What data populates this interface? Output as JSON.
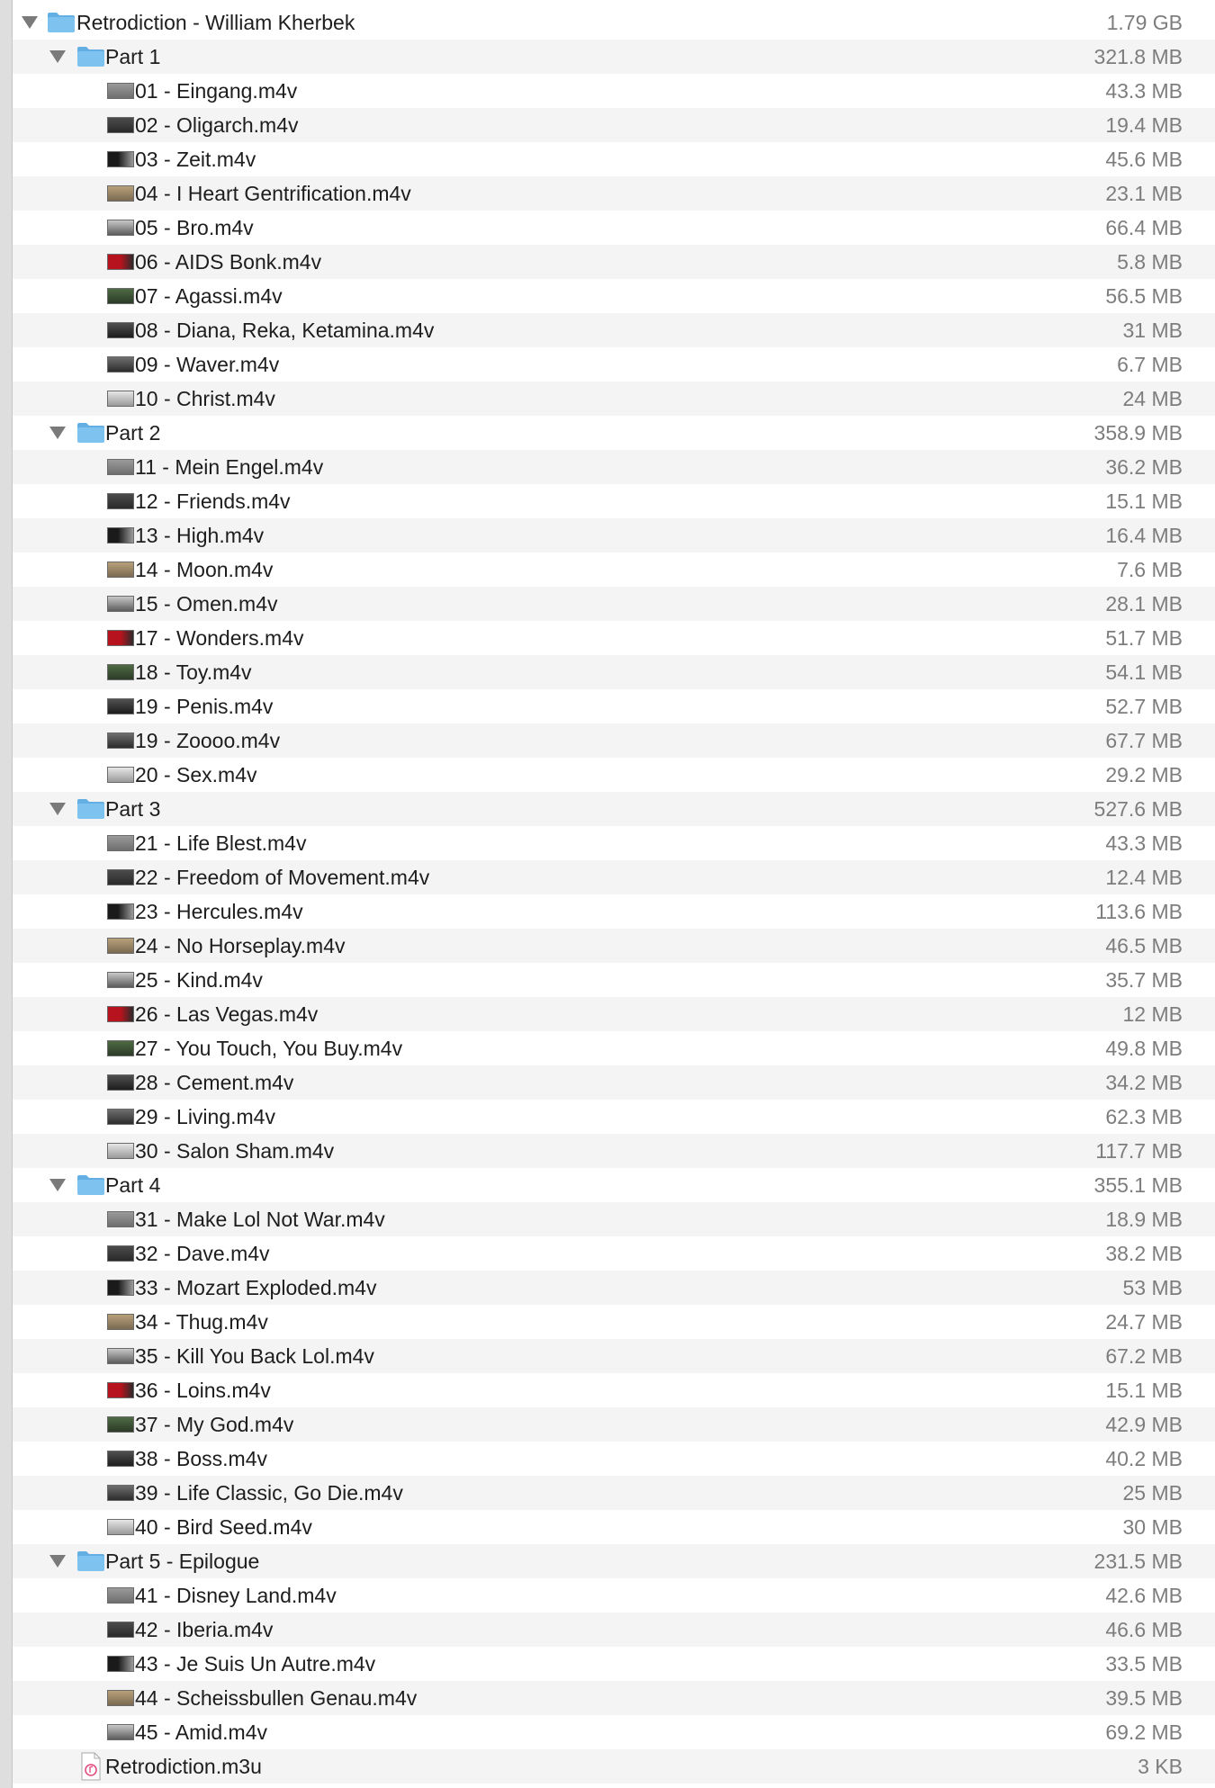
{
  "root": {
    "name": "Retrodiction - William Kherbek",
    "size": "1.79 GB"
  },
  "groups": [
    {
      "name": "Part 1",
      "size": "321.8 MB",
      "files": [
        {
          "name": "01 - Eingang.m4v",
          "size": "43.3 MB"
        },
        {
          "name": "02 - Oligarch.m4v",
          "size": "19.4 MB"
        },
        {
          "name": "03 - Zeit.m4v",
          "size": "45.6 MB"
        },
        {
          "name": "04 - I Heart Gentrification.m4v",
          "size": "23.1 MB"
        },
        {
          "name": "05 - Bro.m4v",
          "size": "66.4 MB"
        },
        {
          "name": "06 - AIDS Bonk.m4v",
          "size": "5.8 MB"
        },
        {
          "name": "07 - Agassi.m4v",
          "size": "56.5 MB"
        },
        {
          "name": "08 - Diana, Reka, Ketamina.m4v",
          "size": "31 MB"
        },
        {
          "name": "09 - Waver.m4v",
          "size": "6.7 MB"
        },
        {
          "name": "10 - Christ.m4v",
          "size": "24 MB"
        }
      ]
    },
    {
      "name": "Part 2",
      "size": "358.9 MB",
      "files": [
        {
          "name": "11 - Mein Engel.m4v",
          "size": "36.2 MB"
        },
        {
          "name": "12 - Friends.m4v",
          "size": "15.1 MB"
        },
        {
          "name": "13 - High.m4v",
          "size": "16.4 MB"
        },
        {
          "name": "14 - Moon.m4v",
          "size": "7.6 MB"
        },
        {
          "name": "15 - Omen.m4v",
          "size": "28.1 MB"
        },
        {
          "name": "17 - Wonders.m4v",
          "size": "51.7 MB"
        },
        {
          "name": "18 - Toy.m4v",
          "size": "54.1 MB"
        },
        {
          "name": "19 - Penis.m4v",
          "size": "52.7 MB"
        },
        {
          "name": "19 - Zoooo.m4v",
          "size": "67.7 MB"
        },
        {
          "name": "20 - Sex.m4v",
          "size": "29.2 MB"
        }
      ]
    },
    {
      "name": "Part 3",
      "size": "527.6 MB",
      "files": [
        {
          "name": "21 - Life Blest.m4v",
          "size": "43.3 MB"
        },
        {
          "name": "22 - Freedom of Movement.m4v",
          "size": "12.4 MB"
        },
        {
          "name": "23 - Hercules.m4v",
          "size": "113.6 MB"
        },
        {
          "name": "24 - No Horseplay.m4v",
          "size": "46.5 MB"
        },
        {
          "name": "25 - Kind.m4v",
          "size": "35.7 MB"
        },
        {
          "name": "26 - Las Vegas.m4v",
          "size": "12 MB"
        },
        {
          "name": "27 - You Touch, You Buy.m4v",
          "size": "49.8 MB"
        },
        {
          "name": "28 - Cement.m4v",
          "size": "34.2 MB"
        },
        {
          "name": "29 - Living.m4v",
          "size": "62.3 MB"
        },
        {
          "name": "30 - Salon Sham.m4v",
          "size": "117.7 MB"
        }
      ]
    },
    {
      "name": "Part 4",
      "size": "355.1 MB",
      "files": [
        {
          "name": "31 - Make Lol Not War.m4v",
          "size": "18.9 MB"
        },
        {
          "name": "32 - Dave.m4v",
          "size": "38.2 MB"
        },
        {
          "name": "33 - Mozart Exploded.m4v",
          "size": "53 MB"
        },
        {
          "name": "34 - Thug.m4v",
          "size": "24.7 MB"
        },
        {
          "name": "35 - Kill You Back Lol.m4v",
          "size": "67.2 MB"
        },
        {
          "name": "36 - Loins.m4v",
          "size": "15.1 MB"
        },
        {
          "name": "37 - My God.m4v",
          "size": "42.9 MB"
        },
        {
          "name": "38 - Boss.m4v",
          "size": "40.2 MB"
        },
        {
          "name": "39 - Life Classic, Go Die.m4v",
          "size": "25 MB"
        },
        {
          "name": "40 - Bird Seed.m4v",
          "size": "30 MB"
        }
      ]
    },
    {
      "name": "Part 5 - Epilogue",
      "size": "231.5 MB",
      "files": [
        {
          "name": "41 - Disney Land.m4v",
          "size": "42.6 MB"
        },
        {
          "name": "42 - Iberia.m4v",
          "size": "46.6 MB"
        },
        {
          "name": "43 - Je Suis Un Autre.m4v",
          "size": "33.5 MB"
        },
        {
          "name": "44 - Scheissbullen Genau.m4v",
          "size": "39.5 MB"
        },
        {
          "name": "45 - Amid.m4v",
          "size": "69.2 MB"
        }
      ]
    }
  ],
  "loose_files": [
    {
      "name": "Retrodiction.m3u",
      "size": "3 KB",
      "icon": "playlist-icon"
    }
  ],
  "icons": {
    "disclosure": "disclosure-triangle-icon",
    "folder": "folder-icon",
    "video": "video-thumbnail-icon"
  },
  "colors": {
    "folder_fill": "#7ec3ef",
    "folder_tab": "#63aee3",
    "stripe": "#f4f4f4",
    "name_text": "#1d1d1d",
    "size_text": "#7d7d7d"
  }
}
